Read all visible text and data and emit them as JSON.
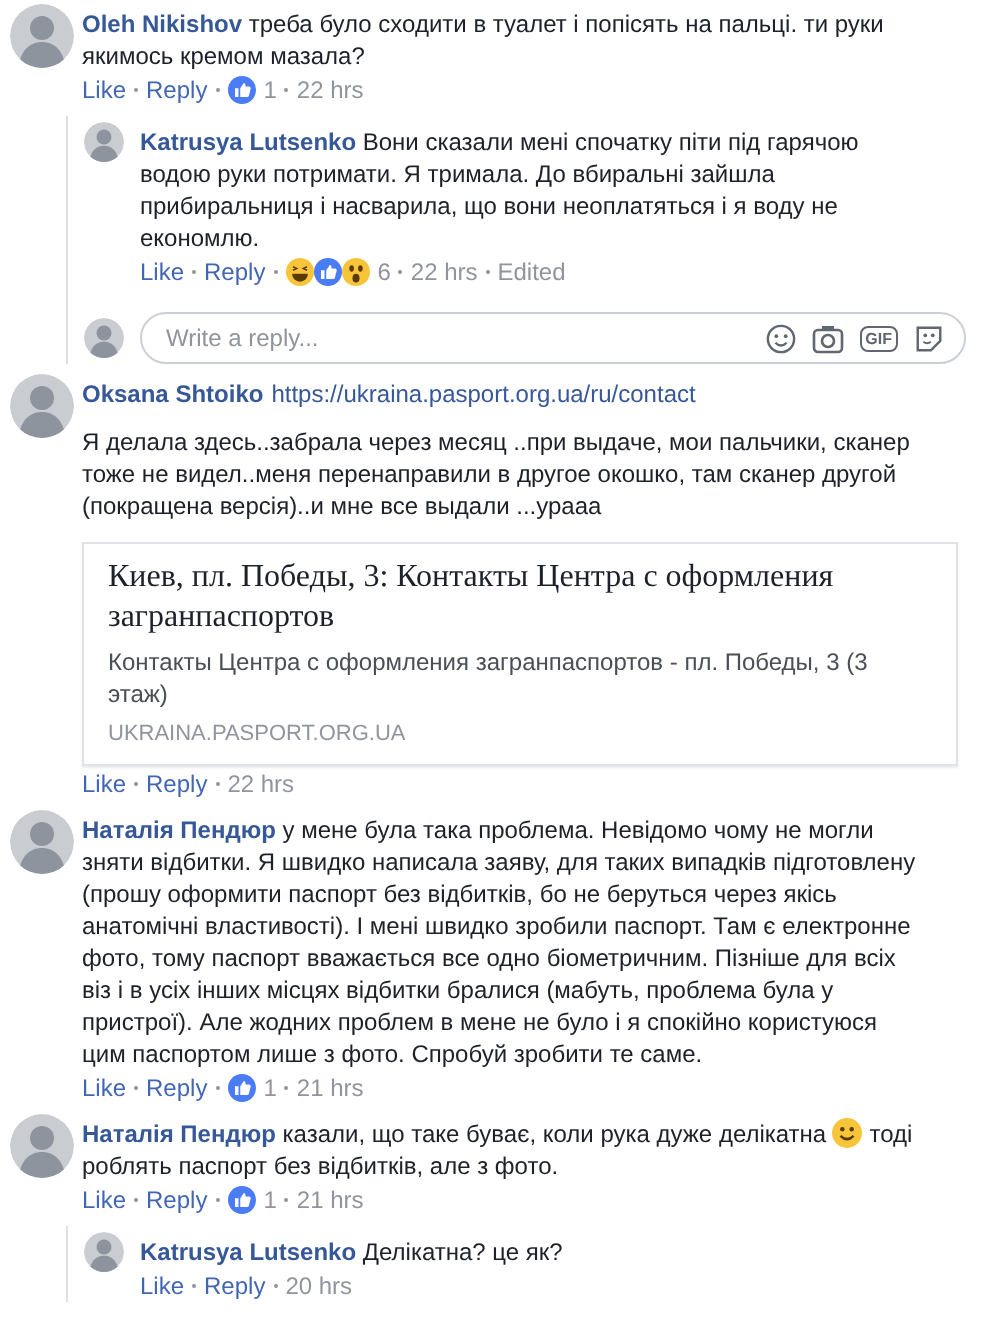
{
  "comments": [
    {
      "author": "Oleh Nikishov",
      "body": [
        {
          "kind": "text",
          "text": "треба було сходити в туалет і попісять на пальці. ти руки якимось кремом мазала?"
        }
      ],
      "actions": {
        "like": "Like",
        "reply": "Reply",
        "reactions": [
          {
            "kind": "like"
          }
        ],
        "count": "1",
        "time": "22 hrs"
      },
      "replies": [
        {
          "author": "Katrusya Lutsenko",
          "body": [
            {
              "kind": "text",
              "text": "Вони сказали мені спочатку піти під гарячою водою руки потримати. Я тримала. До вбиральні зайшла прибиральниця і насварила, що вони неоплатяться і я воду не економлю."
            }
          ],
          "actions": {
            "like": "Like",
            "reply": "Reply",
            "reactions": [
              {
                "kind": "haha"
              },
              {
                "kind": "like"
              },
              {
                "kind": "wow"
              }
            ],
            "count": "6",
            "time": "22 hrs",
            "edited": "Edited"
          }
        }
      ],
      "reply_box": {
        "placeholder": "Write a reply...",
        "gif": "GIF"
      }
    },
    {
      "author": "Oksana Shtoiko",
      "link": "https://ukraina.pasport.org.ua/ru/contact",
      "body": [
        {
          "kind": "text",
          "text": "Я делала здесь..забрала через месяц ..при выдаче, мои пальчики, сканер тоже не видел..меня перенаправили в другое окошко, там сканер другой (покращена версія)..и мне все выдали ...урааа"
        }
      ],
      "link_preview": {
        "title": "Киев, пл. Победы, 3: Контакты Центра с оформления загранпаспортов",
        "description": "Контакты Центра с оформления загранпаспортов - пл. Победы, 3 (3 этаж)",
        "domain": "UKRAINA.PASPORT.ORG.UA"
      },
      "actions": {
        "like": "Like",
        "reply": "Reply",
        "time": "22 hrs"
      }
    },
    {
      "author": "Наталія Пендюр",
      "body": [
        {
          "kind": "text",
          "text": "у мене була така проблема. Невідомо чому не могли зняти відбитки. Я швидко написала заяву, для таких випадків підготовлену (прошу оформити паспорт без відбитків, бо не беруться через якісь анатомічні властивості). І мені швидко зробили паспорт. Там є електронне фото, тому паспорт вважається все одно біометричним. Пізніше для всіх віз і в усіх інших місцях відбитки бралися (мабуть, проблема була у пристрої). Але жодних проблем в мене не було і я спокійно користуюся цим паспортом лише з фото. Спробуй зробити те саме."
        }
      ],
      "actions": {
        "like": "Like",
        "reply": "Reply",
        "reactions": [
          {
            "kind": "like"
          }
        ],
        "count": "1",
        "time": "21 hrs"
      }
    },
    {
      "author": "Наталія Пендюр",
      "body": [
        {
          "kind": "text",
          "text": "казали, що таке буває, коли рука дуже делікатна "
        },
        {
          "kind": "emoji"
        },
        {
          "kind": "text",
          "text": " тоді роблять паспорт без відбитків, але з фото."
        }
      ],
      "actions": {
        "like": "Like",
        "reply": "Reply",
        "reactions": [
          {
            "kind": "like"
          }
        ],
        "count": "1",
        "time": "21 hrs"
      },
      "replies": [
        {
          "author": "Katrusya Lutsenko",
          "body": [
            {
              "kind": "text",
              "text": "Делікатна? це як?"
            }
          ],
          "actions": {
            "like": "Like",
            "reply": "Reply",
            "time": "20 hrs"
          }
        }
      ]
    }
  ]
}
